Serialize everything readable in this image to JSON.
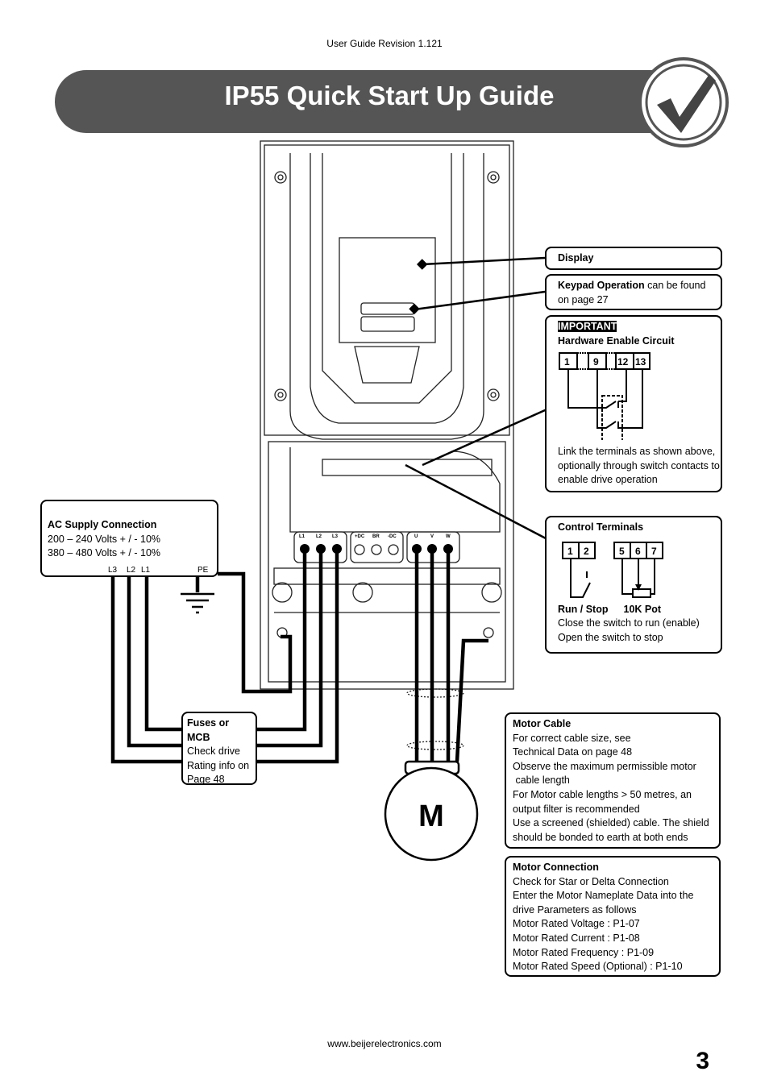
{
  "header": {
    "revision": "User Guide Revision 1.121"
  },
  "banner": {
    "title": "IP55 Quick Start Up Guide",
    "icon": "checkmark-icon"
  },
  "callouts": {
    "display": {
      "title": "Display"
    },
    "keypad": {
      "title": "Keypad Operation",
      "text": " can be found on page 27"
    },
    "important": {
      "badge": "IMPORTANT",
      "title": "Hardware Enable Circuit",
      "terminals": [
        "1",
        "9",
        "12",
        "13"
      ],
      "text": "Link the terminals as shown above, optionally through switch contacts to enable drive operation"
    },
    "control": {
      "title": "Control Terminals",
      "terminals_a": [
        "1",
        "2"
      ],
      "terminals_b": [
        "5",
        "6",
        "7"
      ],
      "label_run": "Run / Stop",
      "label_pot": "10K Pot",
      "line1": "Close the switch to run (enable)",
      "line2": "Open the switch to stop"
    },
    "ac_supply": {
      "title": "AC Supply Connection",
      "line1": "200 – 240 Volts + / - 10%",
      "line2": "380 – 480 Volts + / - 10%",
      "labels": {
        "l3": "L3",
        "l2": "L2",
        "l1": "L1",
        "pe": "PE"
      }
    },
    "fuses": {
      "title": "Fuses or MCB",
      "text": "Check drive Rating info on Page 48"
    },
    "motor_cable": {
      "title": "Motor Cable",
      "lines": [
        "For correct cable size, see",
        "Technical Data on page 48",
        "Observe the maximum permissible motor",
        " cable length",
        "For Motor cable lengths > 50 metres, an output filter is recommended",
        "Use a screened (shielded) cable. The shield should be bonded to earth at both ends"
      ]
    },
    "motor_connection": {
      "title": "Motor Connection",
      "lines": [
        "Check for Star or Delta Connection",
        "Enter the Motor Nameplate Data into the drive Parameters as follows",
        "Motor Rated Voltage : P1-07",
        "Motor Rated Current : P1-08",
        "Motor Rated Frequency : P1-09",
        "Motor Rated Speed (Optional) : P1-10"
      ]
    }
  },
  "drive": {
    "terminals_in": [
      "L1",
      "L2",
      "L3"
    ],
    "terminals_dc": [
      "+DC",
      "BR",
      "-DC"
    ],
    "terminals_out": [
      "U",
      "V",
      "W"
    ]
  },
  "motor": {
    "label": "M"
  },
  "footer": {
    "url": "www.beijerelectronics.com",
    "page": "3"
  }
}
